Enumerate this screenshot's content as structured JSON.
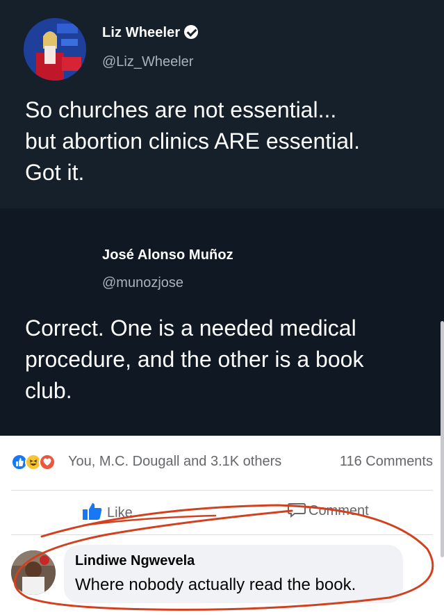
{
  "tweet1": {
    "author_name": "Liz Wheeler",
    "author_handle": "@Liz_Wheeler",
    "text_lines": [
      "So churches are not essential...",
      "but abortion clinics ARE essential.",
      "Got it."
    ]
  },
  "tweet2": {
    "author_name": "José Alonso Muñoz",
    "author_handle": "@munozjose",
    "text_lines": [
      "Correct. One is a needed medical",
      "procedure, and the other is a book",
      "club."
    ]
  },
  "facebook": {
    "reactions_text": "You, M.C. Dougall and 3.1K others",
    "comments_count": "116 Comments",
    "like_label": "Like",
    "comment_label": "Comment",
    "comment": {
      "author": "Lindiwe Ngwevela",
      "text": "Where nobody actually read the book."
    }
  },
  "colors": {
    "tweet_bg": "#15202b",
    "facebook_blue": "#1877f2",
    "annotation_red": "#d2401e"
  },
  "icons": [
    "verified-badge-icon",
    "like-reaction-icon",
    "haha-reaction-icon",
    "wow-reaction-icon",
    "thumbs-up-icon",
    "comment-bubble-icon"
  ]
}
